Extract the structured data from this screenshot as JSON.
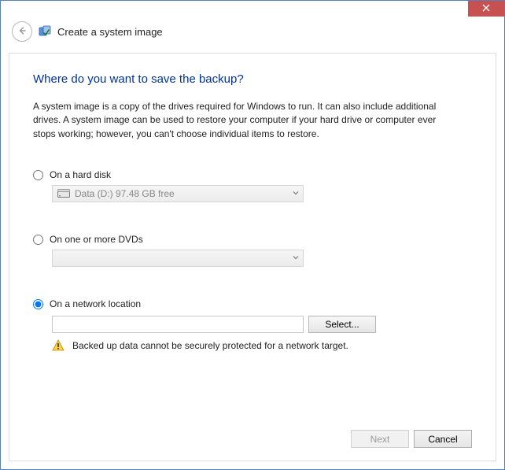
{
  "window": {
    "title": "Create a system image"
  },
  "heading": "Where do you want to save the backup?",
  "description": "A system image is a copy of the drives required for Windows to run. It can also include additional drives. A system image can be used to restore your computer if your hard drive or computer ever stops working; however, you can't choose individual items to restore.",
  "options": {
    "hard_disk": {
      "label": "On a hard disk",
      "selected": false,
      "drive_display": "Data (D:)  97.48 GB free"
    },
    "dvd": {
      "label": "On one or more DVDs",
      "selected": false,
      "drive_display": ""
    },
    "network": {
      "label": "On a network location",
      "selected": true,
      "path": "",
      "select_button": "Select...",
      "warning": "Backed up data cannot be securely protected for a network target."
    }
  },
  "footer": {
    "next": "Next",
    "cancel": "Cancel",
    "next_enabled": false
  }
}
